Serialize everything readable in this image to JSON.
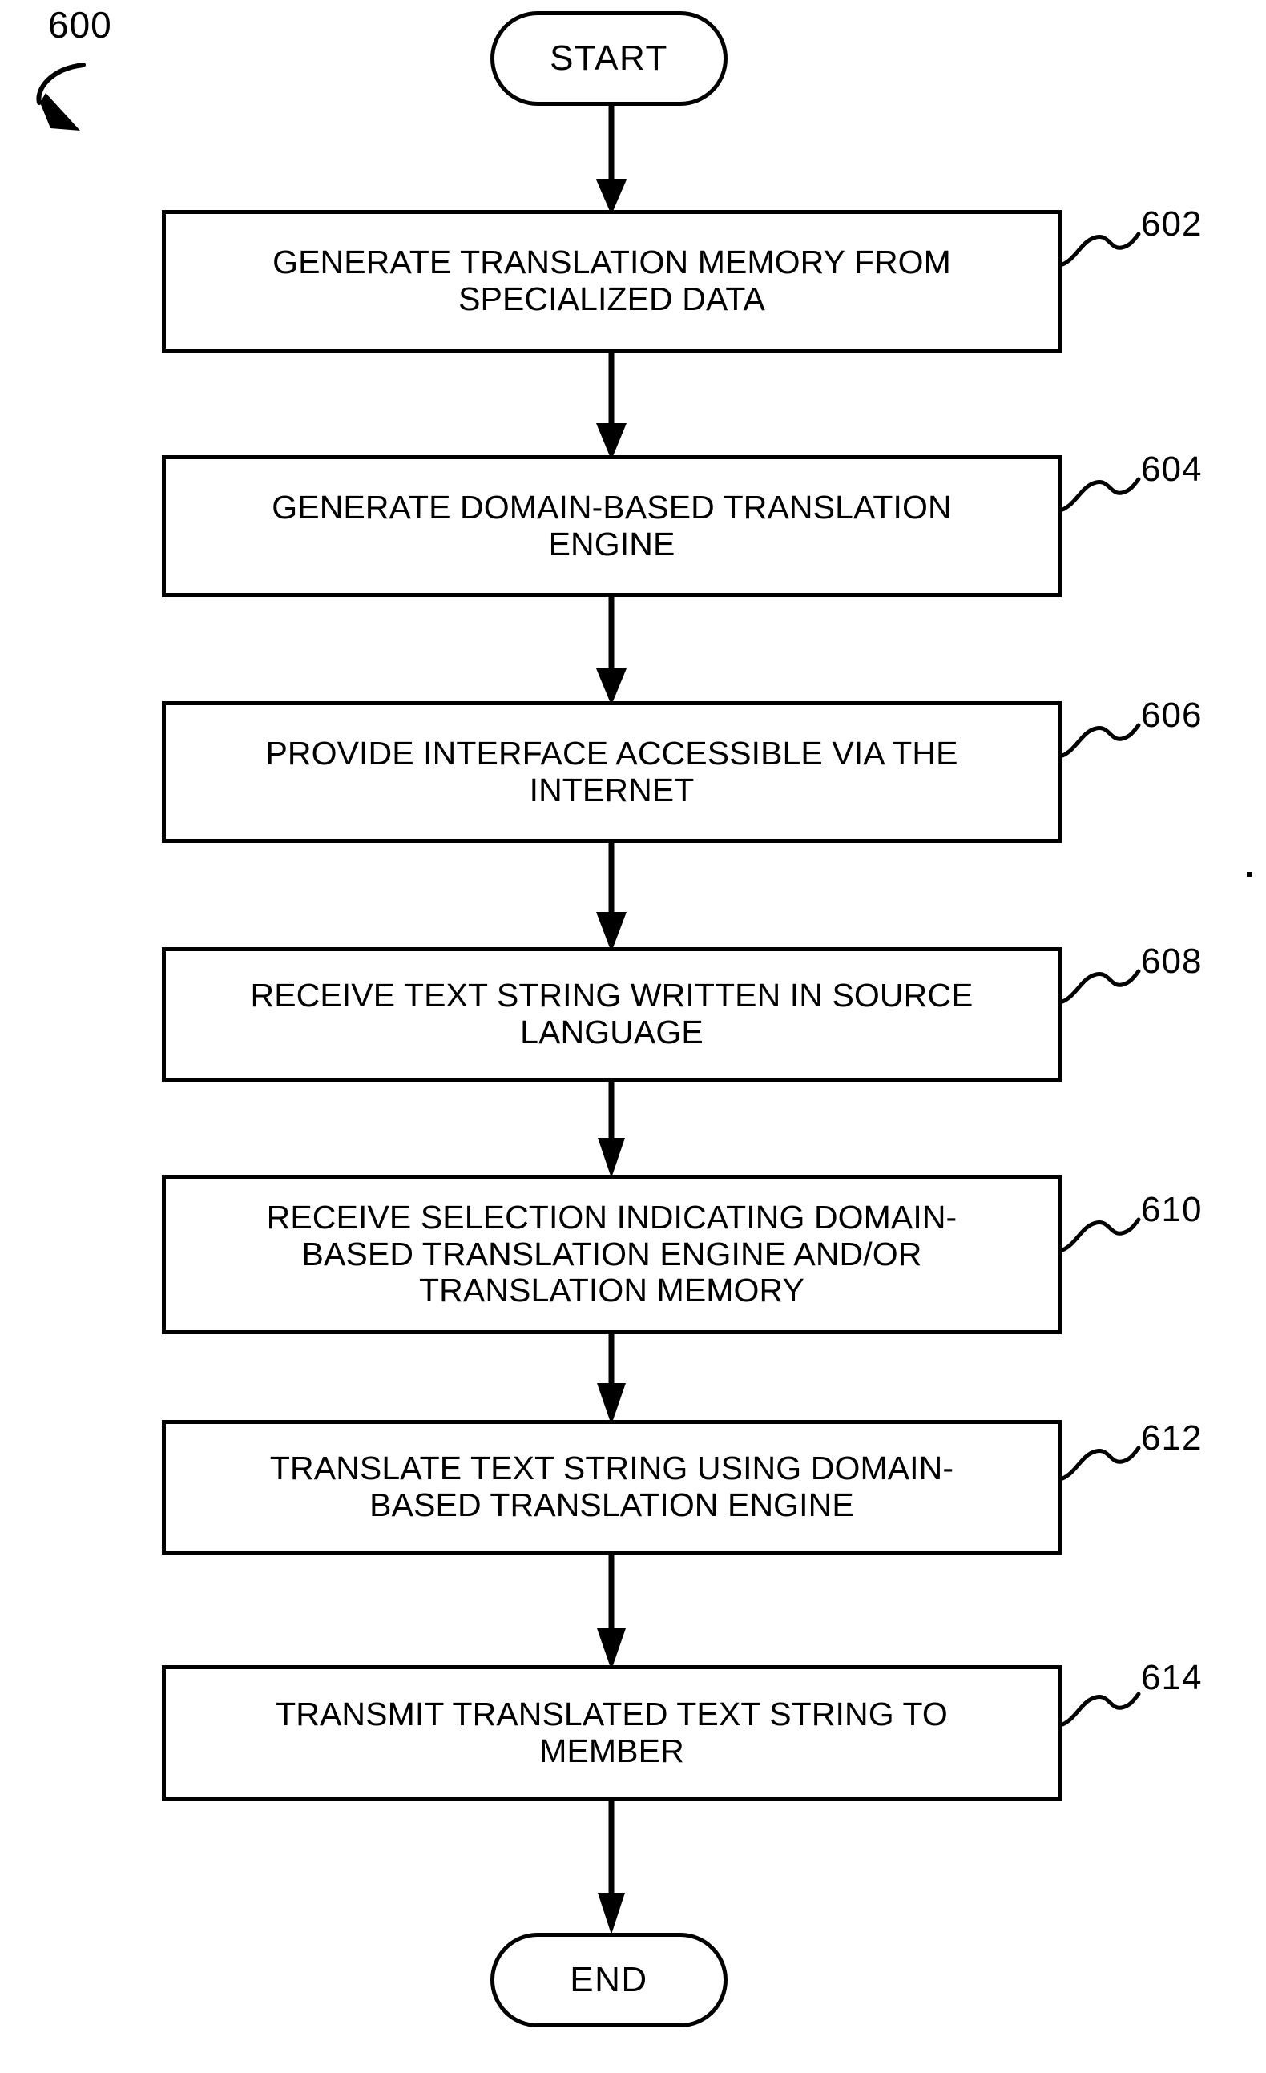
{
  "figure": {
    "number": "600",
    "type": "process-flowchart",
    "title_visible": false
  },
  "nodes": {
    "start": {
      "label": "START",
      "shape": "stadium"
    },
    "end": {
      "label": "END",
      "shape": "stadium"
    },
    "steps": [
      {
        "ref": "602",
        "text": "GENERATE TRANSLATION MEMORY FROM\nSPECIALIZED DATA",
        "lines": [
          "GENERATE TRANSLATION MEMORY FROM",
          "SPECIALIZED DATA"
        ]
      },
      {
        "ref": "604",
        "text": "GENERATE DOMAIN-BASED TRANSLATION\nENGINE",
        "lines": [
          "GENERATE DOMAIN-BASED TRANSLATION",
          "ENGINE"
        ]
      },
      {
        "ref": "606",
        "text": "PROVIDE INTERFACE ACCESSIBLE VIA THE\nINTERNET",
        "lines": [
          "PROVIDE INTERFACE ACCESSIBLE VIA THE",
          "INTERNET"
        ]
      },
      {
        "ref": "608",
        "text": "RECEIVE TEXT STRING WRITTEN IN SOURCE\nLANGUAGE",
        "lines": [
          "RECEIVE TEXT STRING WRITTEN IN SOURCE",
          "LANGUAGE"
        ]
      },
      {
        "ref": "610",
        "text": "RECEIVE SELECTION INDICATING DOMAIN-\nBASED TRANSLATION ENGINE AND/OR\nTRANSLATION MEMORY",
        "lines": [
          "RECEIVE SELECTION INDICATING DOMAIN-",
          "BASED TRANSLATION ENGINE AND/OR",
          "TRANSLATION MEMORY"
        ]
      },
      {
        "ref": "612",
        "text": "TRANSLATE TEXT STRING USING DOMAIN-\nBASED TRANSLATION ENGINE",
        "lines": [
          "TRANSLATE TEXT STRING USING DOMAIN-",
          "BASED TRANSLATION ENGINE"
        ]
      },
      {
        "ref": "614",
        "text": "TRANSMIT TRANSLATED TEXT STRING TO\nMEMBER",
        "lines": [
          "TRANSMIT TRANSLATED TEXT STRING TO",
          "MEMBER"
        ]
      }
    ]
  },
  "connectors": {
    "count": 8,
    "style": "vertical-line-with-solid-arrowhead",
    "direction": "downward",
    "color": "#000000"
  },
  "style": {
    "line_color": "#000000",
    "fill_color": "#ffffff",
    "background": "#ffffff"
  }
}
